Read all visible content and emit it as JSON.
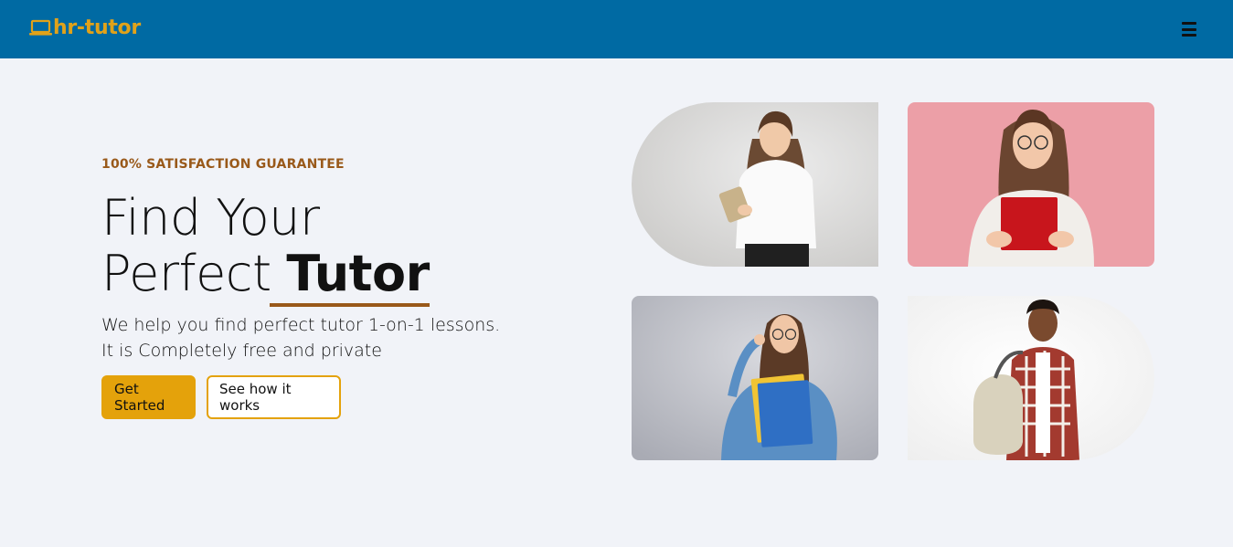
{
  "navbar": {
    "brand": "hr-tutor",
    "brand_icon": "laptop-icon",
    "menu_icon": "hamburger-menu-icon",
    "background": "#006aa3",
    "brand_color": "#e0a21a"
  },
  "hero": {
    "eyebrow": "100% SATISFACTION GUARANTEE",
    "headline_line1": "Find Your",
    "headline_line2_regular": "Perfect ",
    "headline_line2_bold": "Tutor",
    "subtext_line1": "We help you find perfect tutor 1-on-1 lessons.",
    "subtext_line2": "It is Completely free and private",
    "primary_button": "Get Started",
    "secondary_button": "See how it works",
    "accent_color": "#e4a20b",
    "eyebrow_color": "#99591a"
  },
  "photos": [
    {
      "name": "tutor-photo-tablet",
      "description_icon": "person-photo"
    },
    {
      "name": "tutor-photo-red-book",
      "description_icon": "person-photo"
    },
    {
      "name": "tutor-photo-blue-folders",
      "description_icon": "person-photo"
    },
    {
      "name": "tutor-photo-backpack",
      "description_icon": "person-photo"
    }
  ]
}
